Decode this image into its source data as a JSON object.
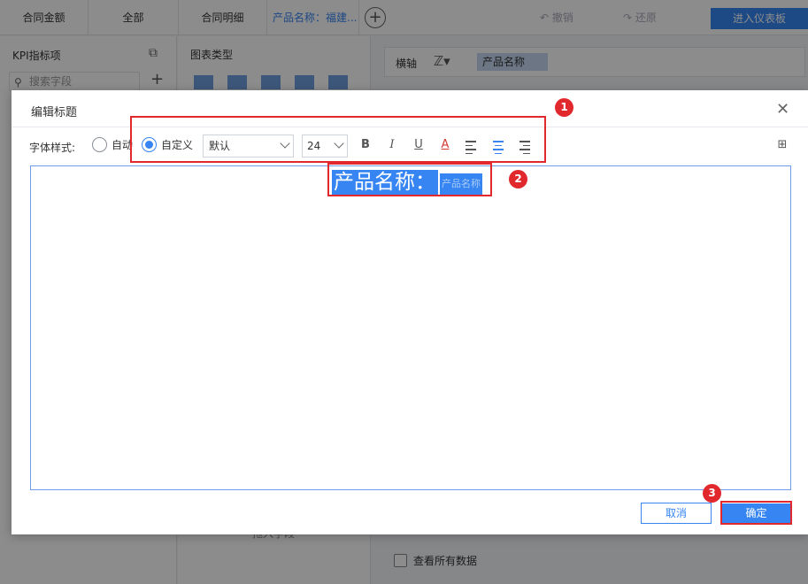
{
  "tabbar": {
    "tabs": [
      "合同金额",
      "全部",
      "合同明细",
      "产品名称：福建..."
    ],
    "add_icon": "plus-circle-icon",
    "undo": "撤销",
    "redo": "还原",
    "enter_dashboard": "进入仪表板"
  },
  "kpi_panel": {
    "title": "KPI指标项",
    "search_placeholder": "搜索字段",
    "add_icon": "plus-icon"
  },
  "chart_panel": {
    "title": "图表类型",
    "drag_field": "拖入字段"
  },
  "right_panel": {
    "axis_label": "横轴",
    "axis_chip": "产品名称",
    "show_all_data": "查看所有数据"
  },
  "dialog": {
    "title": "编辑标题",
    "font_style_label": "字体样式:",
    "radio_auto": "自动",
    "radio_custom": "自定义",
    "font_value": "默认",
    "size_value": "24",
    "bold": "B",
    "italic": "I",
    "underline": "U",
    "font_color": "A",
    "editor_text_main": "产品名称：",
    "editor_text_field": "产品名称",
    "cancel": "取消",
    "ok": "确定"
  },
  "annotations": {
    "badge1": "1",
    "badge2": "2",
    "badge3": "3"
  },
  "colors": {
    "accent": "#3685f2",
    "annotation": "#e0282d"
  }
}
